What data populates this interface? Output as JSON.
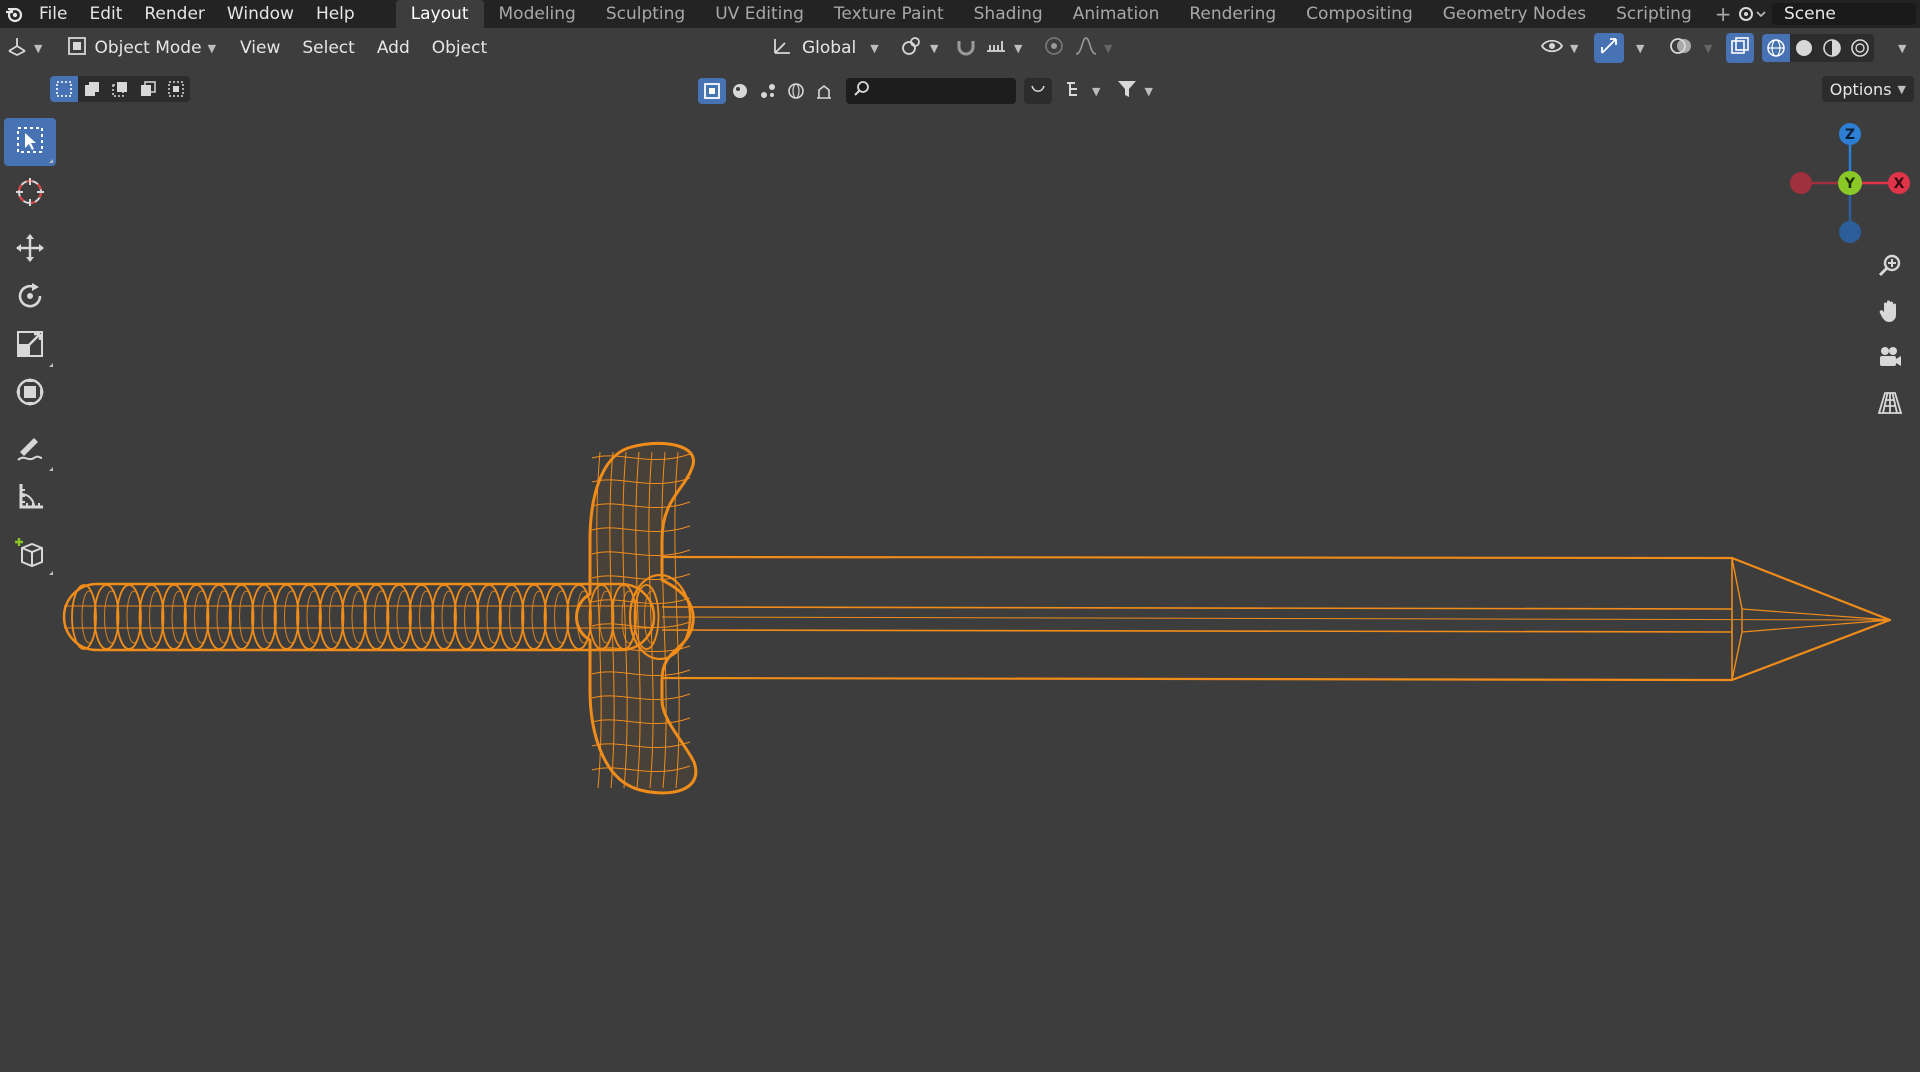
{
  "topbar": {
    "menus": [
      "File",
      "Edit",
      "Render",
      "Window",
      "Help"
    ],
    "workspace_tabs": [
      "Layout",
      "Modeling",
      "Sculpting",
      "UV Editing",
      "Texture Paint",
      "Shading",
      "Animation",
      "Rendering",
      "Compositing",
      "Geometry Nodes",
      "Scripting"
    ],
    "active_tab": "Layout",
    "add_tab": "+",
    "scene_name": "Scene"
  },
  "header": {
    "mode": "Object Mode",
    "menus": [
      "View",
      "Select",
      "Add",
      "Object"
    ],
    "orientation": "Global",
    "options_label": "Options"
  },
  "search": {
    "placeholder": ""
  },
  "gizmo": {
    "z": "Z",
    "y": "Y",
    "x": "X"
  },
  "colors": {
    "wire": "#f08c19",
    "accent": "#4772b3",
    "axis_x": "#e0344b",
    "axis_y": "#8ac827",
    "axis_z": "#2c7fd4",
    "background": "#3d3d3d"
  },
  "icons": {
    "toolbar": [
      "select-box-icon",
      "cursor-icon",
      "move-icon",
      "rotate-icon",
      "scale-icon",
      "transform-icon",
      "annotate-icon",
      "measure-icon",
      "add-cube-icon"
    ],
    "nav": [
      "zoom-icon",
      "pan-hand-icon",
      "camera-icon",
      "perspective-grid-icon"
    ]
  }
}
